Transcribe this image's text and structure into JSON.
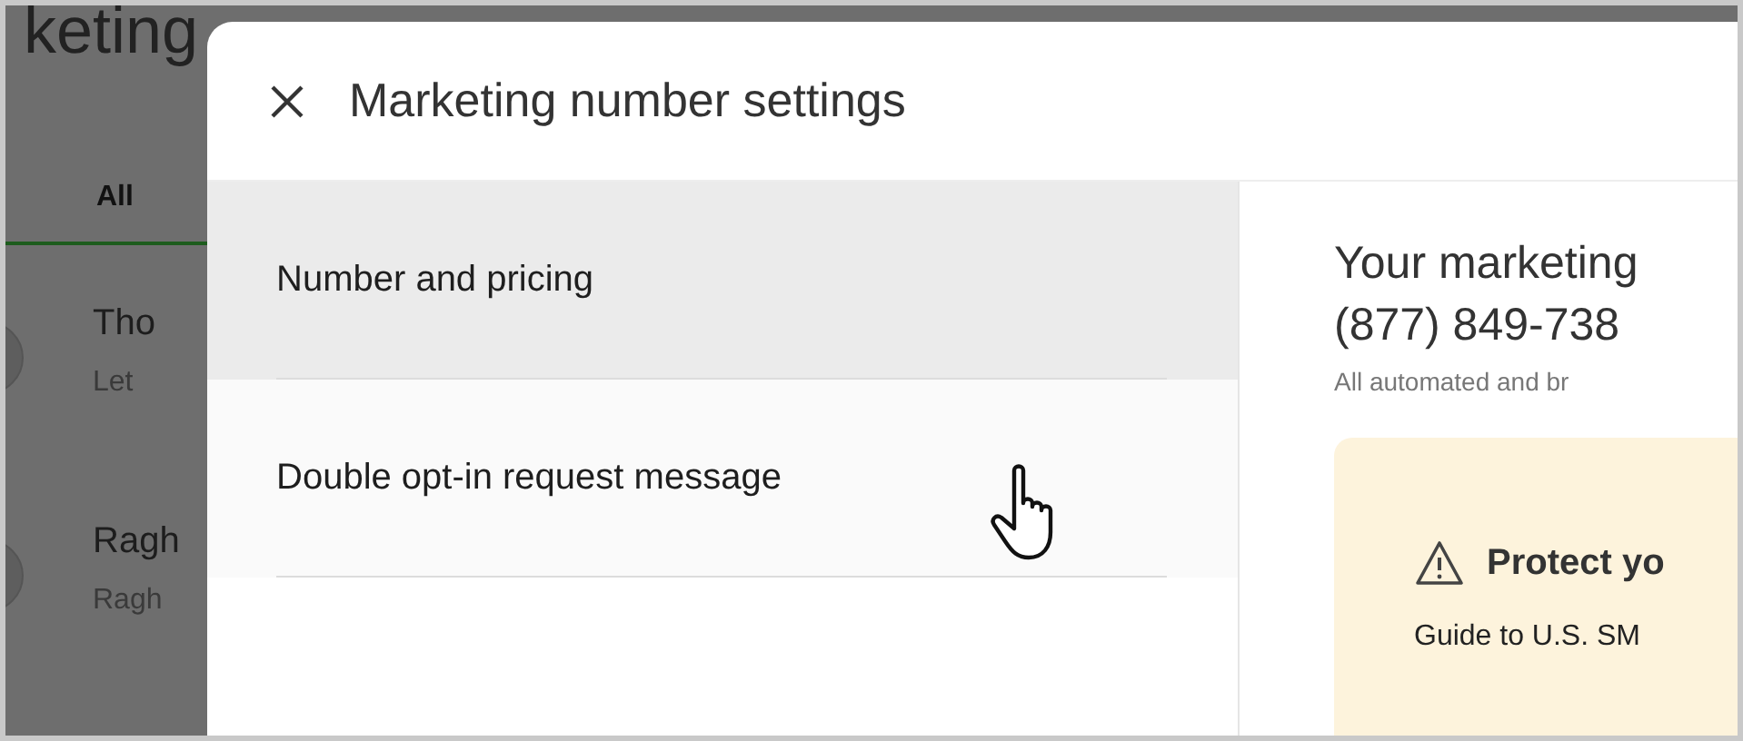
{
  "background_page": {
    "title": "keting",
    "tabs": [
      {
        "label": "All",
        "selected": true
      }
    ],
    "conversations": [
      {
        "name": "Tho",
        "preview": "Let"
      },
      {
        "name": "Ragh",
        "preview": "Ragh"
      }
    ]
  },
  "modal": {
    "title": "Marketing number settings",
    "nav": [
      {
        "label": "Number and pricing",
        "selected": true,
        "hovered": false
      },
      {
        "label": "Double opt-in request message",
        "selected": false,
        "hovered": true
      }
    ],
    "content": {
      "heading": "Your marketing",
      "number": "(877) 849-738",
      "note": "All automated and br",
      "warning": {
        "title": "Protect yo",
        "text": "Guide to U.S. SM"
      }
    }
  }
}
